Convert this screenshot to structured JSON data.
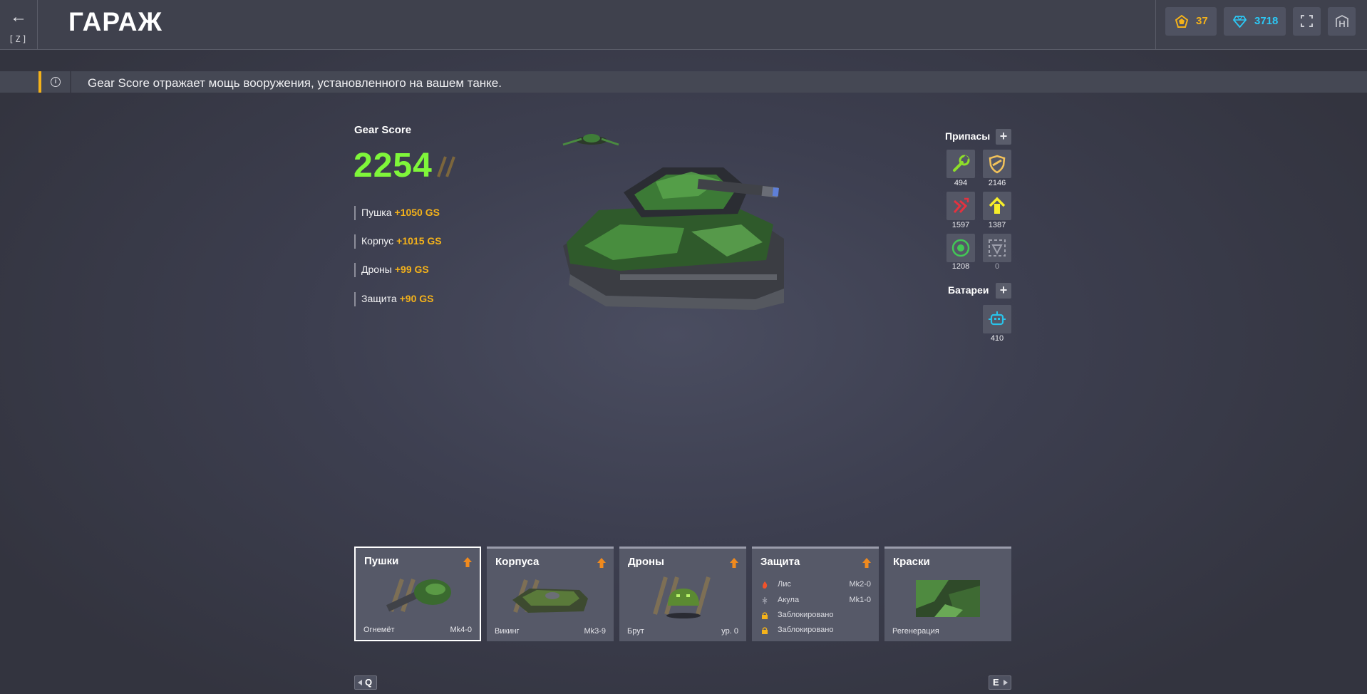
{
  "header": {
    "back_key": "[Z]",
    "title": "ГАРАЖ",
    "crystals": "37",
    "diamonds": "3718"
  },
  "info": {
    "text": "Gear Score отражает мощь вооружения, установленного на вашем танке."
  },
  "gear_score": {
    "label": "Gear Score",
    "value": "2254",
    "rows": [
      {
        "name": "Пушка",
        "plus": "+1050 GS"
      },
      {
        "name": "Корпус",
        "plus": "+1015 GS"
      },
      {
        "name": "Дроны",
        "plus": "+99 GS"
      },
      {
        "name": "Защита",
        "plus": "+90 GS"
      }
    ]
  },
  "supplies": {
    "title": "Припасы",
    "items": [
      {
        "icon": "repair-kit-icon",
        "count": "494"
      },
      {
        "icon": "double-armor-icon",
        "count": "2146"
      },
      {
        "icon": "double-damage-icon",
        "count": "1597"
      },
      {
        "icon": "speed-boost-icon",
        "count": "1387"
      },
      {
        "icon": "mine-icon",
        "count": "1208"
      },
      {
        "icon": "gold-box-icon",
        "count": "0"
      }
    ]
  },
  "batteries": {
    "title": "Батареи",
    "count": "410"
  },
  "cards": [
    {
      "title": "Пушки",
      "item": "Огнемёт",
      "level": "Mk4-0"
    },
    {
      "title": "Корпуса",
      "item": "Викинг",
      "level": "Mk3-9"
    },
    {
      "title": "Дроны",
      "item": "Брут",
      "level": "ур. 0"
    },
    {
      "title": "Защита",
      "modules": [
        {
          "name": "Лис",
          "mk": "Mk2-0"
        },
        {
          "name": "Акула",
          "mk": "Mk1-0"
        },
        {
          "name": "Заблокировано",
          "mk": ""
        },
        {
          "name": "Заблокировано",
          "mk": ""
        }
      ]
    },
    {
      "title": "Краски",
      "item": "Регенерация",
      "level": ""
    }
  ],
  "nav": {
    "prev_key": "Q",
    "next_key": "E"
  },
  "colors": {
    "accent_yellow": "#f4b21a",
    "gear_score_green": "#7ff63a",
    "diamond_blue": "#2cc8f5"
  }
}
